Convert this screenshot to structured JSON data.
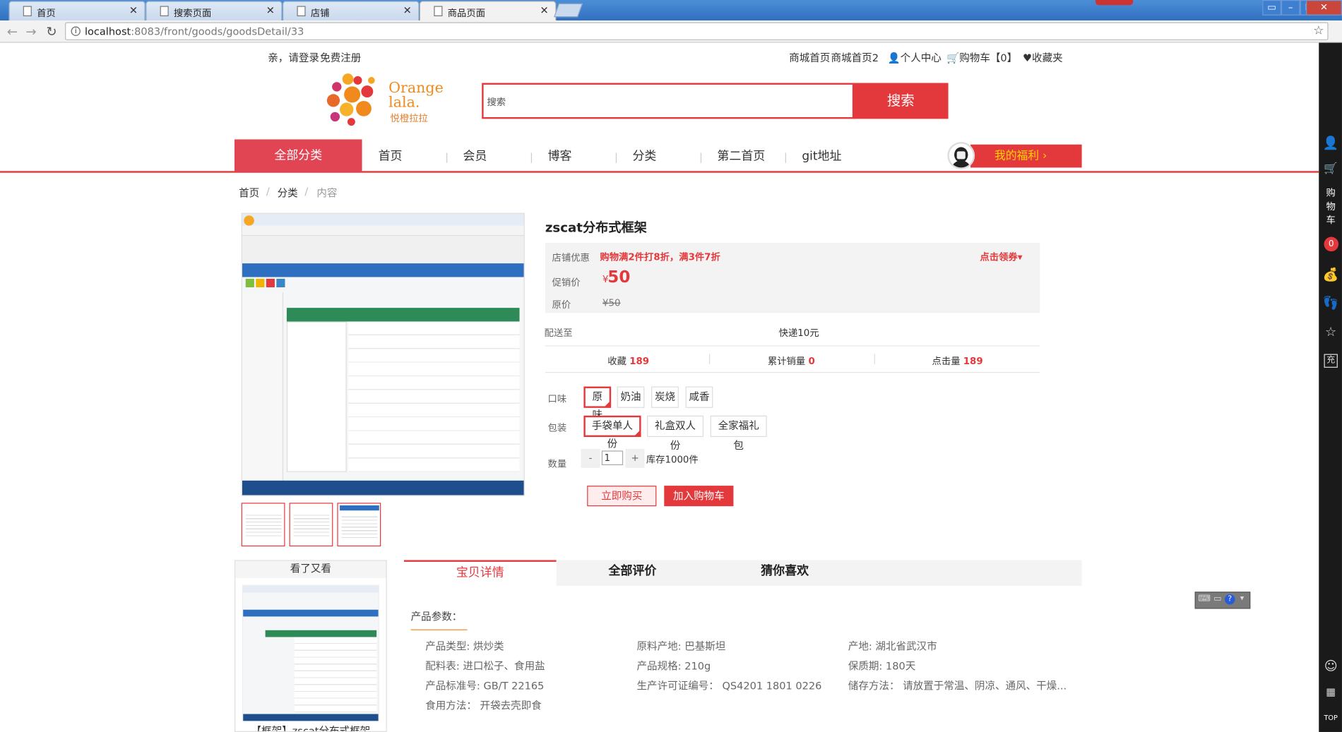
{
  "browser": {
    "tabs": [
      "首页",
      "搜索页面",
      "店铺",
      "商品页面"
    ],
    "active_tab": 3,
    "url_host": "localhost",
    "url_path": ":8083/front/goods/goodsDetail/33"
  },
  "topbar": {
    "greeting": "亲，请登录",
    "register": "免费注册",
    "links": [
      "商城首页",
      "商城首页2",
      "个人中心",
      "购物车【0】",
      "收藏夹"
    ]
  },
  "logo": {
    "text1": "Orange",
    "text2": "lala.",
    "slogan": "悦橙拉拉"
  },
  "search": {
    "placeholder": "搜索",
    "button": "搜索"
  },
  "nav": {
    "all_categories": "全部分类",
    "items": [
      "首页",
      "会员",
      "博客",
      "分类",
      "第二首页",
      "git地址"
    ],
    "welfare": "我的福利 ›"
  },
  "breadcrumb": [
    "首页",
    "分类",
    "内容"
  ],
  "product": {
    "title": "zscat分布式框架",
    "promo_label": "店铺优惠",
    "promo_text": "购物满2件打8折，满3件7折",
    "coupon": "点击领券",
    "sale_label": "促销价",
    "currency": "¥",
    "sale_price": "50",
    "orig_label": "原价",
    "orig_price": "¥50",
    "ship_label": "配送至",
    "ship_fee": "快递10元",
    "stats": [
      {
        "label": "收藏",
        "value": "189"
      },
      {
        "label": "累计销量",
        "value": "0"
      },
      {
        "label": "点击量",
        "value": "189"
      }
    ],
    "flavor_label": "口味",
    "flavors": [
      "原味",
      "奶油",
      "炭烧",
      "咸香"
    ],
    "pack_label": "包装",
    "packs": [
      "手袋单人份",
      "礼盒双人份",
      "全家福礼包"
    ],
    "qty_label": "数量",
    "qty_minus": "-",
    "qty_plus": "+",
    "qty_value": "1",
    "stock": "库存1000件",
    "buy_now": "立即购买",
    "add_cart": "加入购物车"
  },
  "sidebar": {
    "title": "看了又看",
    "item_title": "【框架】zscat分布式框架"
  },
  "detail_tabs": [
    "宝贝详情",
    "全部评价",
    "猜你喜欢"
  ],
  "params": {
    "heading": "产品参数：",
    "rows": [
      [
        "产品类型: 烘炒类",
        "原料产地: 巴基斯坦",
        "产地: 湖北省武汉市"
      ],
      [
        "配料表: 进口松子、食用盐",
        "产品规格: 210g",
        "保质期: 180天"
      ],
      [
        "产品标准号: GB/T 22165",
        "生产许可证编号： QS4201 1801 0226",
        "储存方法： 请放置于常温、阴凉、通风、干燥..."
      ],
      [
        "食用方法： 开袋去壳即食",
        "",
        ""
      ]
    ]
  },
  "right_sidebar": {
    "cart_text": "购物车",
    "cart_count": "0",
    "top": "TOP",
    "chong": "充"
  }
}
